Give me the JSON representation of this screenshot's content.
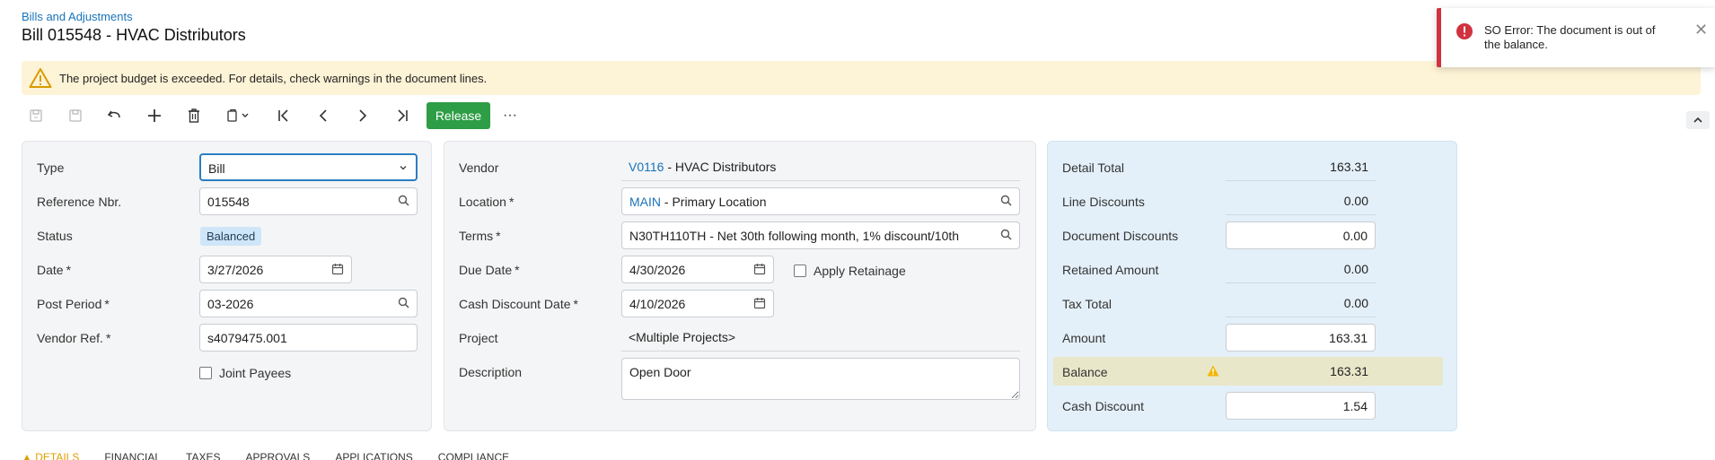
{
  "breadcrumb": "Bills and Adjustments",
  "title": "Bill 015548 - HVAC Distributors",
  "warning": "The project budget is exceeded. For details, check warnings in the document lines.",
  "toolbar": {
    "release_label": "Release",
    "more_label": "···"
  },
  "toast": {
    "message": "SO Error: The document is out of the balance.",
    "close": "✕"
  },
  "left": {
    "type_label": "Type",
    "type_value": "Bill",
    "ref_label": "Reference Nbr.",
    "ref_value": "015548",
    "status_label": "Status",
    "status_value": "Balanced",
    "date_label": "Date",
    "date_value": "3/27/2026",
    "period_label": "Post Period",
    "period_value": "03-2026",
    "vendref_label": "Vendor Ref.",
    "vendref_value": "s4079475.001",
    "joint_label": "Joint Payees",
    "req": "*"
  },
  "middle": {
    "vendor_label": "Vendor",
    "vendor_code": "V0116",
    "vendor_name": " - HVAC Distributors",
    "location_label": "Location",
    "location_code": "MAIN",
    "location_name": " - Primary Location",
    "terms_label": "Terms",
    "terms_value": "N30TH110TH - Net 30th following month, 1% discount/10th",
    "due_label": "Due Date",
    "due_value": "4/30/2026",
    "retainage_label": "Apply Retainage",
    "cashdisc_date_label": "Cash Discount Date",
    "cashdisc_date_value": "4/10/2026",
    "project_label": "Project",
    "project_value": "<Multiple Projects>",
    "desc_label": "Description",
    "desc_value": "Open Door"
  },
  "right": {
    "detail_total_label": "Detail Total",
    "detail_total": "163.31",
    "line_disc_label": "Line Discounts",
    "line_disc": "0.00",
    "doc_disc_label": "Document Discounts",
    "doc_disc": "0.00",
    "retained_label": "Retained Amount",
    "retained": "0.00",
    "tax_label": "Tax Total",
    "tax": "0.00",
    "amount_label": "Amount",
    "amount": "163.31",
    "balance_label": "Balance",
    "balance": "163.31",
    "cash_disc_label": "Cash Discount",
    "cash_disc": "1.54"
  },
  "tabs": [
    "DETAILS",
    "FINANCIAL",
    "TAXES",
    "APPROVALS",
    "APPLICATIONS",
    "COMPLIANCE"
  ],
  "colors": {
    "accent": "#1a73b8",
    "release": "#2e9e46",
    "error": "#d0323f",
    "warning_bg": "#fdf3d6",
    "summary_bg": "#e4f0f9"
  }
}
